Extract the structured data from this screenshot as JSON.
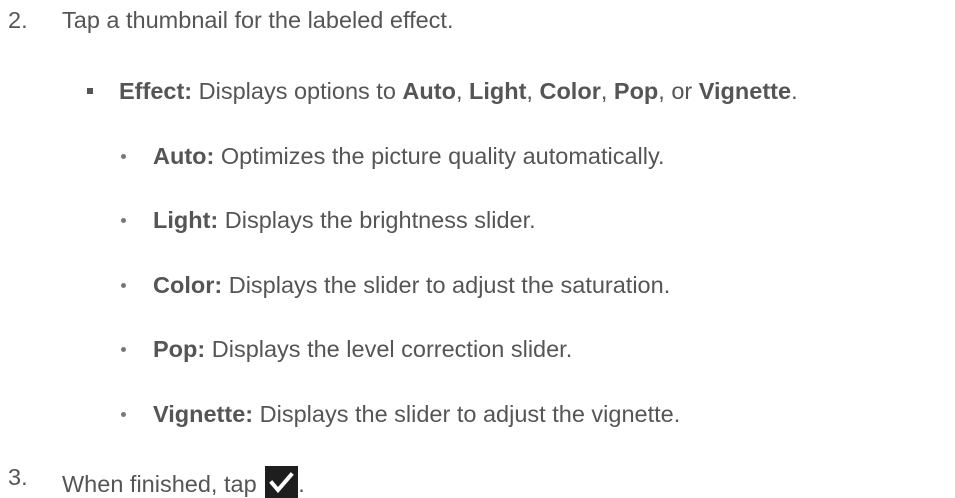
{
  "step2": {
    "number": "2.",
    "text": "Tap a thumbnail for the labeled effect."
  },
  "effect": {
    "label": "Effect:",
    "text_before": " Displays options to ",
    "opt1": "Auto",
    "sep1": ", ",
    "opt2": "Light",
    "sep2": ", ",
    "opt3": "Color",
    "sep3": ", ",
    "opt4": "Pop",
    "sep4": ", or ",
    "opt5": "Vignette",
    "end": "."
  },
  "options": [
    {
      "label": "Auto:",
      "desc": " Optimizes the picture quality automatically."
    },
    {
      "label": "Light:",
      "desc": " Displays the brightness slider."
    },
    {
      "label": "Color:",
      "desc": " Displays the slider to adjust the saturation."
    },
    {
      "label": "Pop:",
      "desc": " Displays the level correction slider."
    },
    {
      "label": "Vignette:",
      "desc": " Displays the slider to adjust the vignette."
    }
  ],
  "step3": {
    "number": "3.",
    "text": "When finished, tap ",
    "end": "."
  },
  "icons": {
    "check": "checkmark-icon",
    "check_bg": "#1e1e1e",
    "check_fg": "#ffffff"
  }
}
